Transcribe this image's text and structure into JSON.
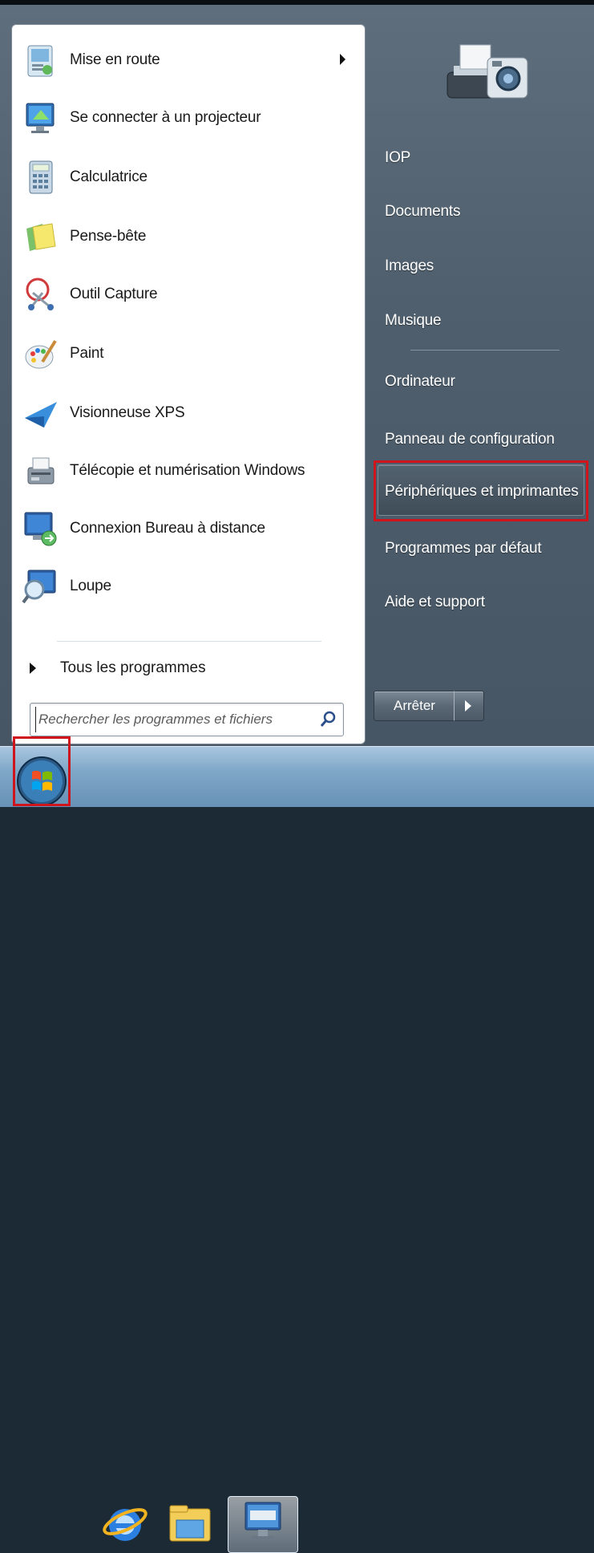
{
  "start_menu": {
    "programs": [
      {
        "label": "Mise en route",
        "icon": "getting-started-icon",
        "has_submenu": true
      },
      {
        "label": "Se connecter à un projecteur",
        "icon": "projector-icon"
      },
      {
        "label": "Calculatrice",
        "icon": "calculator-icon"
      },
      {
        "label": "Pense-bête",
        "icon": "sticky-notes-icon"
      },
      {
        "label": "Outil Capture",
        "icon": "snipping-tool-icon"
      },
      {
        "label": "Paint",
        "icon": "paint-icon"
      },
      {
        "label": "Visionneuse XPS",
        "icon": "xps-viewer-icon"
      },
      {
        "label": "Télécopie et numérisation Windows",
        "icon": "fax-scan-icon"
      },
      {
        "label": "Connexion Bureau à distance",
        "icon": "remote-desktop-icon"
      },
      {
        "label": "Loupe",
        "icon": "magnifier-icon"
      }
    ],
    "all_programs_label": "Tous les programmes",
    "search": {
      "placeholder": "Rechercher les programmes et fichiers"
    },
    "places": [
      {
        "label": "IOP"
      },
      {
        "label": "Documents"
      },
      {
        "label": "Images"
      },
      {
        "label": "Musique"
      },
      {
        "label": "Ordinateur"
      },
      {
        "label": "Panneau de configuration"
      },
      {
        "label": "Périphériques et imprimantes",
        "highlighted": true
      },
      {
        "label": "Programmes par défaut"
      },
      {
        "label": "Aide et support"
      }
    ],
    "shutdown_label": "Arrêter"
  },
  "taskbar": {
    "items": [
      "start-orb-icon",
      "internet-explorer-icon",
      "windows-explorer-icon",
      "on-screen-keyboard-icon"
    ]
  },
  "colors": {
    "highlight": "#d0141c",
    "taskbar": "#7fa7c8",
    "menu_right": "#4f5f6d"
  }
}
